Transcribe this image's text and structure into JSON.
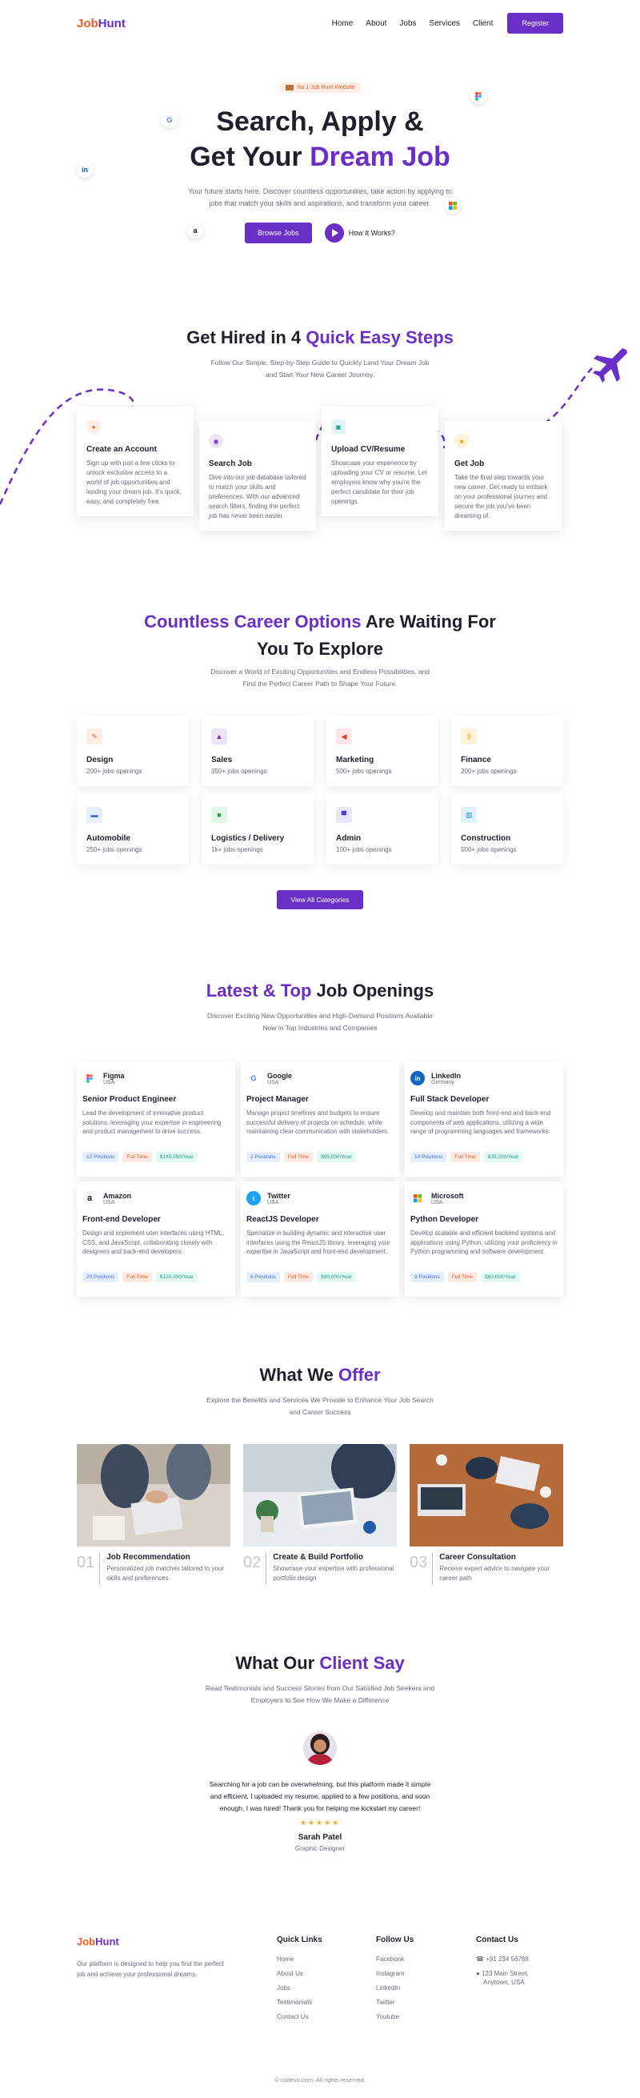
{
  "nav": {
    "logo_a": "Job",
    "logo_b": "Hunt",
    "links": [
      "Home",
      "About",
      "Jobs",
      "Services",
      "Client"
    ],
    "register": "Register"
  },
  "hero": {
    "badge": "No.1 Job Hunt Website",
    "title_line1": "Search, Apply &",
    "title_line2_a": "Get Your ",
    "title_line2_b": "Dream Job",
    "desc": "Your future starts here. Discover countless opportunities, take action by applying to jobs that match your skills and aspirations, and transform your career.",
    "browse": "Browse Jobs",
    "how": "How It Works?"
  },
  "steps": {
    "title_a": "Get Hired in 4 ",
    "title_b": "Quick Easy Steps",
    "sub1": "Follow Our Simple, Step-by-Step Guide to Quickly Land Your Dream Job",
    "sub2": "and Start Your New Career Journey.",
    "items": [
      {
        "title": "Create an Account",
        "desc": "Sign up with just a few clicks to unlock exclusive access to a world of job opportunities and landing your dream job. It's quick, easy, and completely free."
      },
      {
        "title": "Search Job",
        "desc": "Dive into our job database tailored to match your skills and preferences. With our advanced search filters, finding the perfect job has never been easier."
      },
      {
        "title": "Upload CV/Resume",
        "desc": "Showcase your experience by uploading your CV or resume. Let employers know why you're the perfect candidate for their job openings."
      },
      {
        "title": "Get Job",
        "desc": "Take the final step towards your new career. Get ready to embark on your professional journey and secure the job you've been dreaming of."
      }
    ]
  },
  "categories": {
    "title_a": "Countless Career Options",
    "title_b": " Are Waiting For",
    "title_c": "You To Explore",
    "sub1": "Discover a World of Exciting Opportunities and Endless Possibilities, and",
    "sub2": "Find the Perfect Career Path to Shape Your Future.",
    "items": [
      {
        "name": "Design",
        "count": "200+ jobs openings"
      },
      {
        "name": "Sales",
        "count": "350+ jobs openings"
      },
      {
        "name": "Marketing",
        "count": "500+ jobs openings"
      },
      {
        "name": "Finance",
        "count": "200+ jobs openings"
      },
      {
        "name": "Automobile",
        "count": "250+ jobs openings"
      },
      {
        "name": "Logistics / Delivery",
        "count": "1k+ jobs openings"
      },
      {
        "name": "Admin",
        "count": "100+ jobs openings"
      },
      {
        "name": "Construction",
        "count": "500+ jobs openings"
      }
    ],
    "view_all": "View All Categories"
  },
  "jobs": {
    "title_a": "Latest & Top",
    "title_b": " Job Openings",
    "sub1": "Discover Exciting New Opportunities and High-Demand Positions Available",
    "sub2": "Now in Top Industries and Companies",
    "items": [
      {
        "company": "Figma",
        "location": "USA",
        "title": "Senior Product Engineer",
        "desc": "Lead the development of innovative product solutions, leveraging your expertise in engineering and product management to drive success.",
        "positions": "12 Positions",
        "type": "Full Time",
        "salary": "$145,000/Year"
      },
      {
        "company": "Google",
        "location": "USA",
        "title": "Project Manager",
        "desc": "Manage project timelines and budgets to ensure successful delivery of projects on schedule, while maintaining clear communication with stakeholders.",
        "positions": "2 Positions",
        "type": "Full Time",
        "salary": "$95,000/Year"
      },
      {
        "company": "LinkedIn",
        "location": "Germany",
        "title": "Full Stack Developer",
        "desc": "Develop and maintain both front-end and back-end components of web applications, utilizing a wide range of programming languages and frameworks.",
        "positions": "10 Positions",
        "type": "Full Time",
        "salary": "$35,000/Year"
      },
      {
        "company": "Amazon",
        "location": "USA",
        "title": "Front-end Developer",
        "desc": "Design and implement user interfaces using HTML, CSS, and JavaScript, collaborating closely with designers and back-end developers.",
        "positions": "20 Positions",
        "type": "Full Time",
        "salary": "$120,000/Year"
      },
      {
        "company": "Twitter",
        "location": "USA",
        "title": "ReactJS Developer",
        "desc": "Specialize in building dynamic and interactive user interfaces using the ReactJS library, leveraging your expertise in JavaScript and front-end development.",
        "positions": "6 Positions",
        "type": "Full Time",
        "salary": "$30,000/Year"
      },
      {
        "company": "Microsoft",
        "location": "USA",
        "title": "Python Developer",
        "desc": "Develop scalable and efficient backend systems and applications using Python, utilizing your proficiency in Python programming and software development.",
        "positions": "9 Positions",
        "type": "Full Time",
        "salary": "$80,000/Year"
      }
    ]
  },
  "offer": {
    "title_a": "What We ",
    "title_b": "Offer",
    "sub1": "Explore the Benefits and Services We Provide to Enhance Your Job Search",
    "sub2": "and Career Success",
    "items": [
      {
        "num": "01",
        "title": "Job Recommendation",
        "desc": "Personalized job matches tailored to your skills and preferences"
      },
      {
        "num": "02",
        "title": "Create & Build Portfolio",
        "desc": "Showcase your expertise with professional portfolio design"
      },
      {
        "num": "03",
        "title": "Career Consultation",
        "desc": "Receive expert advice to navigate your career path"
      }
    ]
  },
  "testimonial": {
    "title_a": "What Our ",
    "title_b": "Client Say",
    "sub1": "Read Testimonials and Success Stories from Our Satisfied Job Seekers and",
    "sub2": "Employers to See How We Make a Difference",
    "quote1": "Searching for a job can be overwhelming, but this platform made it simple",
    "quote2": "and efficient. I uploaded my resume, applied to a few positions, and soon",
    "quote3": "enough, I was hired! Thank you for helping me kickstart my career!",
    "stars": "★★★★★",
    "name": "Sarah Patel",
    "role": "Graphic Designer"
  },
  "footer": {
    "desc": "Our platform is designed to help you find the perfect job and achieve your professional dreams.",
    "quick_title": "Quick Links",
    "quick": [
      "Home",
      "About Us",
      "Jobs",
      "Testimonials",
      "Contact Us"
    ],
    "follow_title": "Follow Us",
    "follow": [
      "Facebook",
      "Instagram",
      "LinkedIn",
      "Twitter",
      "Youtube"
    ],
    "contact_title": "Contact Us",
    "phone": "+91 234 56788",
    "address1": "123 Main Street,",
    "address2": "Anytown, USA",
    "copyright": "© codevo.com. All rights reserved."
  }
}
